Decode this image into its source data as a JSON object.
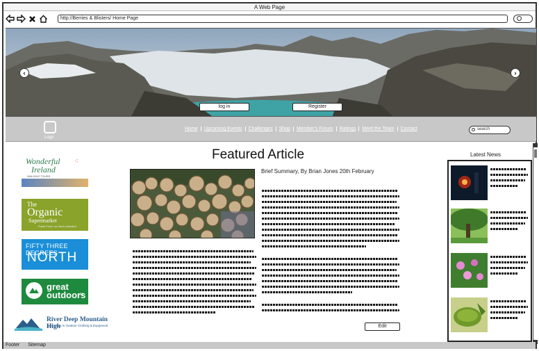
{
  "window": {
    "title": "A Web Page"
  },
  "browser": {
    "url": "http://Berries & Blisters/ Home Page"
  },
  "hero": {
    "login_label": "log in",
    "register_label": "Register"
  },
  "menu": {
    "logo_label": "Logo",
    "links": [
      "Home",
      "Upcoming Events",
      "Challenges",
      "Shop",
      "Member's Forum",
      "Ratings",
      "Meet the Team",
      "Contact"
    ],
    "search_placeholder": "search"
  },
  "sponsors": {
    "wonderful_ireland": {
      "line1": "Wonderful",
      "line2": "Ireland",
      "tag": "WALKING TOURS"
    },
    "organic": {
      "line1": "The",
      "line2": "Organic",
      "line3": "Supermarket",
      "tag": "Fresh Food, no Harm Intended"
    },
    "fifty_three": {
      "line1": "FIFTY THREE DEGREES",
      "line2": "NORTH"
    },
    "great_outdoors": {
      "line1": "great",
      "line2": "outdoors",
      "suffix": ".ie"
    },
    "river_deep": {
      "line1": "River Deep Mountain High",
      "line2": "Specialists in Outdoor Clothing & Equipment"
    }
  },
  "article": {
    "title": "Featured Article",
    "summary": "Brief Summary, By Brian Jones 20th February",
    "edit_label": "Edit"
  },
  "news": {
    "title": "Latest News"
  },
  "footer": {
    "footer_label": "Footer",
    "sitemap_label": "Sitemap"
  }
}
